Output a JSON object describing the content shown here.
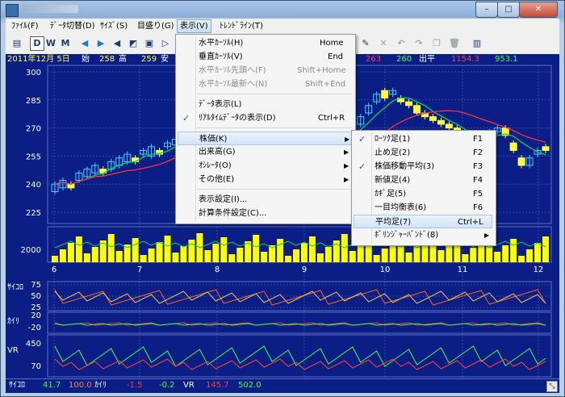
{
  "colors": {
    "chart_bg": "#0b1e86",
    "axis": "#ffffff",
    "up": "#40d0ff",
    "down": "#ffff40",
    "ma_short": "#00d060",
    "ma_long": "#ff3040",
    "volume": "#ffff00",
    "osc1": "#ff6020",
    "osc2": "#e0c060"
  },
  "window": {
    "min": "–",
    "max": "□",
    "close": "✕"
  },
  "menubar": [
    {
      "label": "ﾌｧｲﾙ(F)"
    },
    {
      "label": "ﾃﾞｰﾀ切替(D)"
    },
    {
      "label": "ｻｲｽﾞ(S)"
    },
    {
      "label": "目盛り(G)"
    },
    {
      "label": "表示(V)"
    },
    {
      "label": "ﾄﾚﾝﾄﾞﾗｲﾝ(T)"
    }
  ],
  "toolbar": {
    "print": "print-icon",
    "D": "D",
    "W": "W",
    "M": "M"
  },
  "info": {
    "date": "2011年12月 5日",
    "open_label": "始",
    "open": "258",
    "high_label": "高",
    "high": "259",
    "low_label": "安",
    "v1": "263",
    "v2": "260",
    "out_label": "出平",
    "v3": "1154.3",
    "v4": "953.1"
  },
  "price_axis": [
    "300",
    "285",
    "270",
    "255",
    "240",
    "225"
  ],
  "volume_axis": [
    "2000"
  ],
  "date_axis": [
    "6",
    "7",
    "8",
    "9",
    "10",
    "11",
    "12"
  ],
  "psy_label": "ｻｲｺﾛ",
  "psy_axis": [
    "75",
    "50",
    "25"
  ],
  "kairi_label": "ｶｲﾘ",
  "kairi_axis": [
    "20",
    "-20"
  ],
  "vr_label": "VR",
  "vr_axis": [
    "450",
    "70"
  ],
  "bottom": {
    "psy_label": "ｻｲｺﾛ",
    "psy1": "41.7",
    "psy2": "100.0",
    "kairi_label": "ｶｲﾘ",
    "k1": "-1.5",
    "k2": "-0.2",
    "vr_label": "VR",
    "vr1": "145.7",
    "vr2": "502.0"
  },
  "view_menu": [
    {
      "label": "水平ｶｰｿﾙ(H)",
      "shortcut": "Home"
    },
    {
      "label": "垂直ｶｰｿﾙ(V)",
      "shortcut": "End"
    },
    {
      "label": "水平ｶｰｿﾙ先頭へ(F)",
      "shortcut": "Shift+Home"
    },
    {
      "label": "水平ｶｰｿﾙ最新へ(N)",
      "shortcut": "Shift+End"
    },
    {
      "label": "ﾃﾞｰﾀ表示(L)",
      "shortcut": ""
    },
    {
      "label": "ﾘｱﾙﾀｲﾑﾃﾞｰﾀの表示(D)",
      "shortcut": "Ctrl+R"
    },
    {
      "label": "株価(K)",
      "shortcut": ""
    },
    {
      "label": "出来高(G)",
      "shortcut": ""
    },
    {
      "label": "ｵｼﾚｰﾀ(O)",
      "shortcut": ""
    },
    {
      "label": "その他(E)",
      "shortcut": ""
    },
    {
      "label": "表示設定(I)...",
      "shortcut": ""
    },
    {
      "label": "計算条件設定(C)...",
      "shortcut": ""
    }
  ],
  "price_menu": [
    {
      "label": "ﾛｰｿｸ足(1)",
      "shortcut": "F1"
    },
    {
      "label": "止め足(2)",
      "shortcut": "F2"
    },
    {
      "label": "株価移動平均(3)",
      "shortcut": "F3"
    },
    {
      "label": "新値足(4)",
      "shortcut": "F4"
    },
    {
      "label": "ｶｷﾞ足(5)",
      "shortcut": "F5"
    },
    {
      "label": "一目均衡表(6)",
      "shortcut": "F6"
    },
    {
      "label": "平均足(7)",
      "shortcut": "Ctrl+L"
    },
    {
      "label": "ﾎﾞﾘﾝｼﾞｬｰﾊﾞﾝﾄﾞ(8)",
      "shortcut": ""
    }
  ],
  "price_series": {
    "open": [
      236,
      238,
      240,
      242,
      244,
      246,
      248,
      248,
      250,
      252,
      254,
      256,
      255,
      258,
      260,
      261,
      262,
      262,
      264,
      262,
      266,
      264,
      266,
      268,
      265,
      262,
      258,
      256,
      254,
      252,
      250,
      252,
      256,
      258,
      262,
      264,
      266,
      268,
      272,
      278,
      284,
      290,
      288,
      286,
      284,
      282,
      278,
      276,
      274,
      272,
      270,
      266,
      262,
      264,
      266,
      268,
      270,
      262,
      254,
      250,
      256,
      260
    ],
    "close": [
      240,
      242,
      238,
      246,
      248,
      250,
      246,
      252,
      254,
      256,
      252,
      258,
      260,
      256,
      262,
      264,
      260,
      266,
      262,
      266,
      262,
      268,
      264,
      264,
      262,
      258,
      256,
      254,
      252,
      250,
      252,
      256,
      258,
      262,
      264,
      266,
      268,
      272,
      276,
      282,
      288,
      286,
      290,
      284,
      282,
      278,
      276,
      274,
      272,
      270,
      268,
      262,
      264,
      266,
      268,
      270,
      266,
      258,
      250,
      254,
      258,
      258
    ]
  }
}
